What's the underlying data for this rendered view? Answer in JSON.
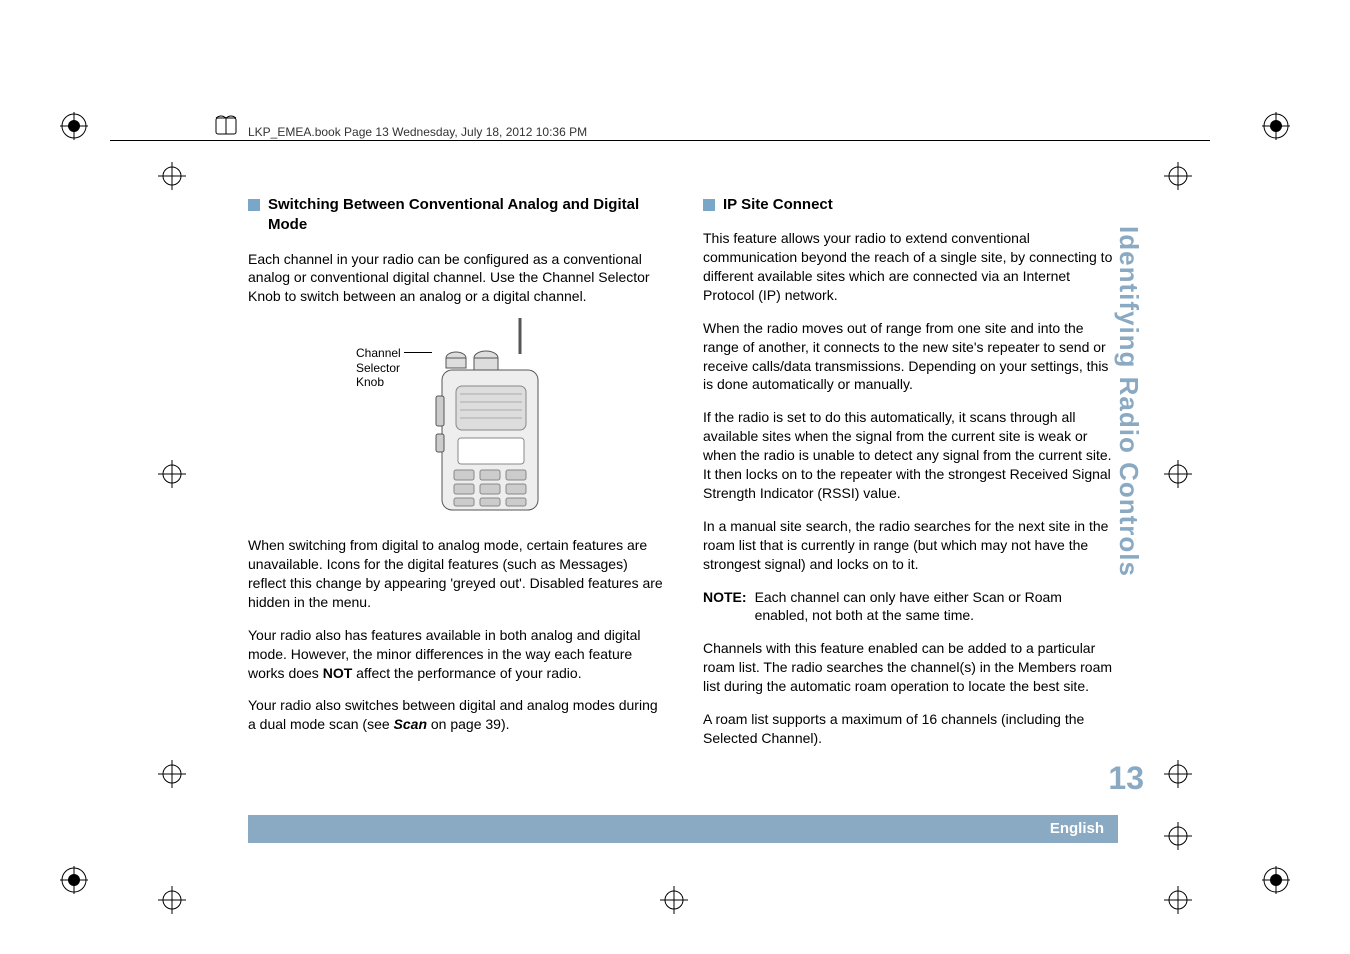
{
  "header": "LKP_EMEA.book  Page 13  Wednesday, July 18, 2012  10:36 PM",
  "left": {
    "title": "Switching Between Conventional Analog and Digital Mode",
    "p1": "Each channel in your radio can be configured as a conventional analog or conventional digital channel. Use the Channel Selector Knob to switch between an analog or a digital channel.",
    "figLabel1": "Channel",
    "figLabel2": "Selector",
    "figLabel3": "Knob",
    "p2a": "When switching from digital to analog mode, certain features are unavailable. Icons for the digital features (such as Messages) reflect this change by appearing 'greyed out'. Disabled features are hidden in the menu.",
    "p3a": "Your radio also has features available in both analog and digital mode. However, the minor differences in the way each feature works does ",
    "p3bold": "NOT",
    "p3b": " affect the performance of your radio.",
    "p4a": "Your radio also switches between digital and analog modes during a dual mode scan (see ",
    "p4italic": "Scan",
    "p4b": " on page 39)."
  },
  "right": {
    "title": "IP Site Connect",
    "p1": "This feature allows your radio to extend conventional communication beyond the reach of a single site, by connecting to different available sites which are connected via an Internet Protocol (IP) network.",
    "p2": "When the radio moves out of range from one site and into the range of another, it connects to the new site's repeater to send or receive calls/data transmissions. Depending on your settings, this is done automatically or manually.",
    "p3": "If the radio is set to do this automatically, it scans through all available sites when the signal from the current site is weak or when the radio is unable to detect any signal from the current site. It then locks on to the repeater with the strongest Received Signal Strength Indicator (RSSI) value.",
    "p4": "In a manual site search, the radio searches for the next site in the roam list that is currently in range (but which may not have the strongest signal) and locks on to it.",
    "noteLabel": "NOTE:",
    "noteText": "Each channel can only have either Scan or Roam enabled, not both at the same time.",
    "p5": "Channels with this feature enabled can be added to a particular roam list. The radio searches the channel(s) in the Members roam list during the automatic roam operation to locate the best site.",
    "p6": "A roam list supports a maximum of 16 channels (including the Selected Channel)."
  },
  "sideTab": "Identifying Radio Controls",
  "pageNum": "13",
  "footer": "English"
}
